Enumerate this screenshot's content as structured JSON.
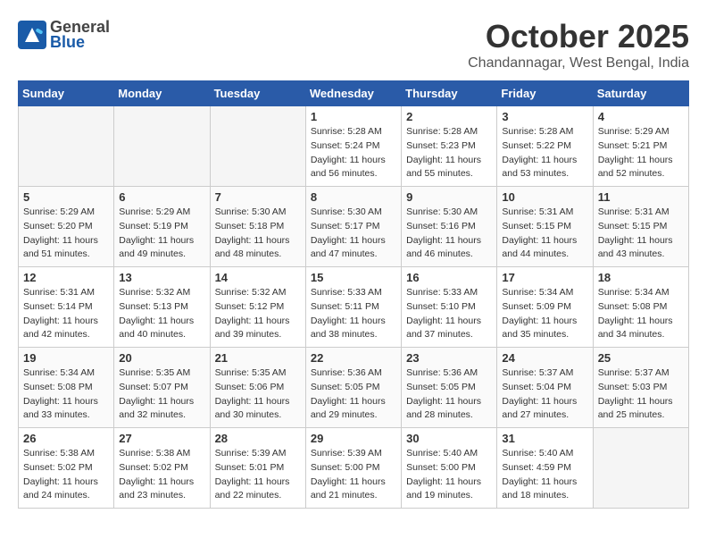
{
  "header": {
    "logo_general": "General",
    "logo_blue": "Blue",
    "title": "October 2025",
    "location": "Chandannagar, West Bengal, India"
  },
  "days_of_week": [
    "Sunday",
    "Monday",
    "Tuesday",
    "Wednesday",
    "Thursday",
    "Friday",
    "Saturday"
  ],
  "weeks": [
    [
      {
        "day": "",
        "sunrise": "",
        "sunset": "",
        "daylight": ""
      },
      {
        "day": "",
        "sunrise": "",
        "sunset": "",
        "daylight": ""
      },
      {
        "day": "",
        "sunrise": "",
        "sunset": "",
        "daylight": ""
      },
      {
        "day": "1",
        "sunrise": "Sunrise: 5:28 AM",
        "sunset": "Sunset: 5:24 PM",
        "daylight": "Daylight: 11 hours and 56 minutes."
      },
      {
        "day": "2",
        "sunrise": "Sunrise: 5:28 AM",
        "sunset": "Sunset: 5:23 PM",
        "daylight": "Daylight: 11 hours and 55 minutes."
      },
      {
        "day": "3",
        "sunrise": "Sunrise: 5:28 AM",
        "sunset": "Sunset: 5:22 PM",
        "daylight": "Daylight: 11 hours and 53 minutes."
      },
      {
        "day": "4",
        "sunrise": "Sunrise: 5:29 AM",
        "sunset": "Sunset: 5:21 PM",
        "daylight": "Daylight: 11 hours and 52 minutes."
      }
    ],
    [
      {
        "day": "5",
        "sunrise": "Sunrise: 5:29 AM",
        "sunset": "Sunset: 5:20 PM",
        "daylight": "Daylight: 11 hours and 51 minutes."
      },
      {
        "day": "6",
        "sunrise": "Sunrise: 5:29 AM",
        "sunset": "Sunset: 5:19 PM",
        "daylight": "Daylight: 11 hours and 49 minutes."
      },
      {
        "day": "7",
        "sunrise": "Sunrise: 5:30 AM",
        "sunset": "Sunset: 5:18 PM",
        "daylight": "Daylight: 11 hours and 48 minutes."
      },
      {
        "day": "8",
        "sunrise": "Sunrise: 5:30 AM",
        "sunset": "Sunset: 5:17 PM",
        "daylight": "Daylight: 11 hours and 47 minutes."
      },
      {
        "day": "9",
        "sunrise": "Sunrise: 5:30 AM",
        "sunset": "Sunset: 5:16 PM",
        "daylight": "Daylight: 11 hours and 46 minutes."
      },
      {
        "day": "10",
        "sunrise": "Sunrise: 5:31 AM",
        "sunset": "Sunset: 5:15 PM",
        "daylight": "Daylight: 11 hours and 44 minutes."
      },
      {
        "day": "11",
        "sunrise": "Sunrise: 5:31 AM",
        "sunset": "Sunset: 5:15 PM",
        "daylight": "Daylight: 11 hours and 43 minutes."
      }
    ],
    [
      {
        "day": "12",
        "sunrise": "Sunrise: 5:31 AM",
        "sunset": "Sunset: 5:14 PM",
        "daylight": "Daylight: 11 hours and 42 minutes."
      },
      {
        "day": "13",
        "sunrise": "Sunrise: 5:32 AM",
        "sunset": "Sunset: 5:13 PM",
        "daylight": "Daylight: 11 hours and 40 minutes."
      },
      {
        "day": "14",
        "sunrise": "Sunrise: 5:32 AM",
        "sunset": "Sunset: 5:12 PM",
        "daylight": "Daylight: 11 hours and 39 minutes."
      },
      {
        "day": "15",
        "sunrise": "Sunrise: 5:33 AM",
        "sunset": "Sunset: 5:11 PM",
        "daylight": "Daylight: 11 hours and 38 minutes."
      },
      {
        "day": "16",
        "sunrise": "Sunrise: 5:33 AM",
        "sunset": "Sunset: 5:10 PM",
        "daylight": "Daylight: 11 hours and 37 minutes."
      },
      {
        "day": "17",
        "sunrise": "Sunrise: 5:34 AM",
        "sunset": "Sunset: 5:09 PM",
        "daylight": "Daylight: 11 hours and 35 minutes."
      },
      {
        "day": "18",
        "sunrise": "Sunrise: 5:34 AM",
        "sunset": "Sunset: 5:08 PM",
        "daylight": "Daylight: 11 hours and 34 minutes."
      }
    ],
    [
      {
        "day": "19",
        "sunrise": "Sunrise: 5:34 AM",
        "sunset": "Sunset: 5:08 PM",
        "daylight": "Daylight: 11 hours and 33 minutes."
      },
      {
        "day": "20",
        "sunrise": "Sunrise: 5:35 AM",
        "sunset": "Sunset: 5:07 PM",
        "daylight": "Daylight: 11 hours and 32 minutes."
      },
      {
        "day": "21",
        "sunrise": "Sunrise: 5:35 AM",
        "sunset": "Sunset: 5:06 PM",
        "daylight": "Daylight: 11 hours and 30 minutes."
      },
      {
        "day": "22",
        "sunrise": "Sunrise: 5:36 AM",
        "sunset": "Sunset: 5:05 PM",
        "daylight": "Daylight: 11 hours and 29 minutes."
      },
      {
        "day": "23",
        "sunrise": "Sunrise: 5:36 AM",
        "sunset": "Sunset: 5:05 PM",
        "daylight": "Daylight: 11 hours and 28 minutes."
      },
      {
        "day": "24",
        "sunrise": "Sunrise: 5:37 AM",
        "sunset": "Sunset: 5:04 PM",
        "daylight": "Daylight: 11 hours and 27 minutes."
      },
      {
        "day": "25",
        "sunrise": "Sunrise: 5:37 AM",
        "sunset": "Sunset: 5:03 PM",
        "daylight": "Daylight: 11 hours and 25 minutes."
      }
    ],
    [
      {
        "day": "26",
        "sunrise": "Sunrise: 5:38 AM",
        "sunset": "Sunset: 5:02 PM",
        "daylight": "Daylight: 11 hours and 24 minutes."
      },
      {
        "day": "27",
        "sunrise": "Sunrise: 5:38 AM",
        "sunset": "Sunset: 5:02 PM",
        "daylight": "Daylight: 11 hours and 23 minutes."
      },
      {
        "day": "28",
        "sunrise": "Sunrise: 5:39 AM",
        "sunset": "Sunset: 5:01 PM",
        "daylight": "Daylight: 11 hours and 22 minutes."
      },
      {
        "day": "29",
        "sunrise": "Sunrise: 5:39 AM",
        "sunset": "Sunset: 5:00 PM",
        "daylight": "Daylight: 11 hours and 21 minutes."
      },
      {
        "day": "30",
        "sunrise": "Sunrise: 5:40 AM",
        "sunset": "Sunset: 5:00 PM",
        "daylight": "Daylight: 11 hours and 19 minutes."
      },
      {
        "day": "31",
        "sunrise": "Sunrise: 5:40 AM",
        "sunset": "Sunset: 4:59 PM",
        "daylight": "Daylight: 11 hours and 18 minutes."
      },
      {
        "day": "",
        "sunrise": "",
        "sunset": "",
        "daylight": ""
      }
    ]
  ]
}
